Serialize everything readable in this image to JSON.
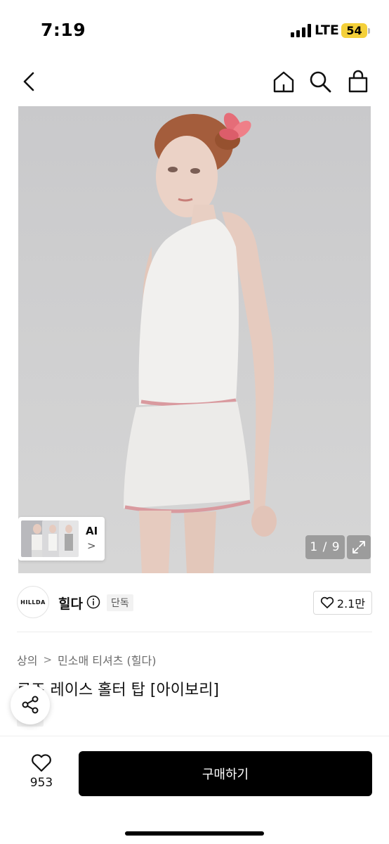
{
  "status_bar": {
    "time": "7:19",
    "network": "LTE",
    "battery": "54",
    "battery_color": "#f4d03a"
  },
  "nav": {
    "icons": [
      "chevron-left-icon",
      "home-icon",
      "search-icon",
      "bag-icon"
    ]
  },
  "gallery": {
    "ai_label": "AI",
    "ai_chevron": ">",
    "counter": "1 / 9"
  },
  "brand": {
    "logo_text": "HILLDA",
    "name": "힐다",
    "exclusive": "단독",
    "likes": "2.1만"
  },
  "breadcrumb": {
    "items": [
      "상의",
      "민소매 티셔츠 (힐다)"
    ],
    "separator": ">"
  },
  "product": {
    "title": "로즈 레이스 홀터 탑 [아이보리]",
    "badge": "단독"
  },
  "bottom": {
    "wish_count": "953",
    "buy_label": "구매하기",
    "buy_color": "#000000"
  }
}
